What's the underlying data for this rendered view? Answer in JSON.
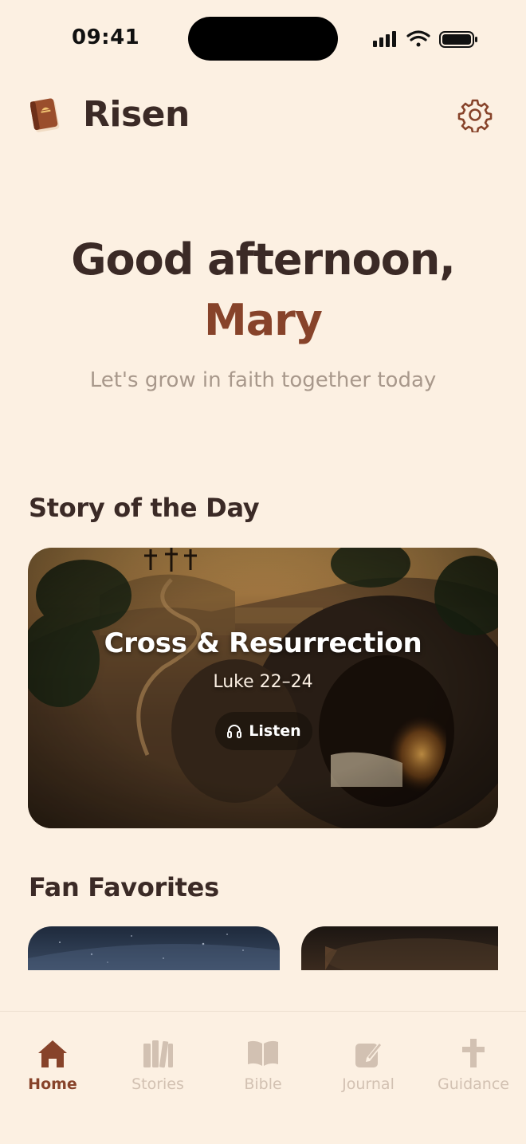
{
  "status_bar": {
    "time": "09:41"
  },
  "header": {
    "app_title": "Risen"
  },
  "greeting": {
    "line1": "Good afternoon,",
    "name": "Mary",
    "subtitle": "Let's grow in faith together today"
  },
  "story_section": {
    "title": "Story of the Day",
    "card": {
      "title": "Cross & Resurrection",
      "reference": "Luke 22–24",
      "listen_label": "Listen"
    }
  },
  "favorites_section": {
    "title": "Fan Favorites"
  },
  "tab_bar": {
    "home": "Home",
    "stories": "Stories",
    "bible": "Bible",
    "journal": "Journal",
    "guidance": "Guidance"
  },
  "colors": {
    "background": "#fcf0e2",
    "accent": "#87432a",
    "text": "#3b2a26",
    "muted": "#a8988b",
    "tab_inactive": "#d2c1b2"
  }
}
